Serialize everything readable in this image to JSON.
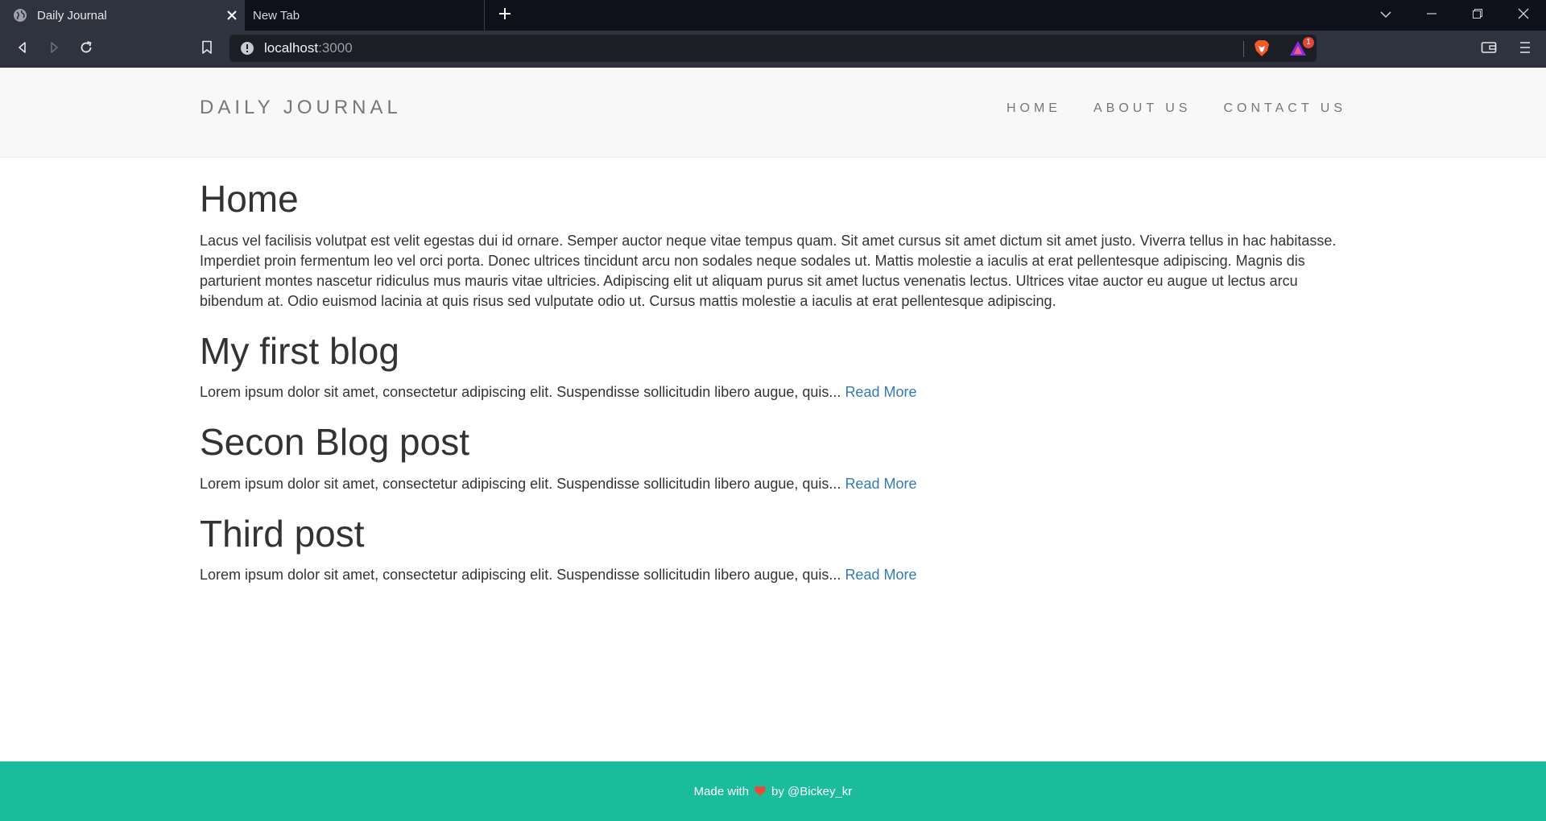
{
  "browser": {
    "tabs": [
      {
        "title": "Daily Journal",
        "active": true
      },
      {
        "title": "New Tab",
        "active": false
      }
    ],
    "url": {
      "host": "localhost",
      "port": ":3000"
    },
    "rewards_badge": "1"
  },
  "site": {
    "brand": "DAILY JOURNAL",
    "nav": [
      {
        "label": "HOME"
      },
      {
        "label": "ABOUT US"
      },
      {
        "label": "CONTACT US"
      }
    ],
    "page_title": "Home",
    "intro": "Lacus vel facilisis volutpat est velit egestas dui id ornare. Semper auctor neque vitae tempus quam. Sit amet cursus sit amet dictum sit amet justo. Viverra tellus in hac habitasse. Imperdiet proin fermentum leo vel orci porta. Donec ultrices tincidunt arcu non sodales neque sodales ut. Mattis molestie a iaculis at erat pellentesque adipiscing. Magnis dis parturient montes nascetur ridiculus mus mauris vitae ultricies. Adipiscing elit ut aliquam purus sit amet luctus venenatis lectus. Ultrices vitae auctor eu augue ut lectus arcu bibendum at. Odio euismod lacinia at quis risus sed vulputate odio ut. Cursus mattis molestie a iaculis at erat pellentesque adipiscing.",
    "posts": [
      {
        "title": "My first blog",
        "excerpt": "Lorem ipsum dolor sit amet, consectetur adipiscing elit. Suspendisse sollicitudin libero augue, quis...",
        "read_more": "Read More"
      },
      {
        "title": "Secon Blog post",
        "excerpt": "Lorem ipsum dolor sit amet, consectetur adipiscing elit. Suspendisse sollicitudin libero augue, quis...",
        "read_more": "Read More"
      },
      {
        "title": "Third post",
        "excerpt": "Lorem ipsum dolor sit amet, consectetur adipiscing elit. Suspendisse sollicitudin libero augue, quis...",
        "read_more": "Read More"
      }
    ],
    "footer": {
      "made_with": "Made with",
      "by": "by @Bickey_kr"
    }
  },
  "colors": {
    "footer_bg": "#1abc9c",
    "link": "#337ab7",
    "heart": "#e74c3c"
  },
  "icons": [
    "globe-icon",
    "close-icon",
    "plus-icon",
    "chevron-down-icon",
    "minimize-icon",
    "restore-icon",
    "back-icon",
    "forward-icon",
    "reload-icon",
    "bookmark-icon",
    "info-icon",
    "brave-shield-icon",
    "brave-rewards-icon",
    "wallet-icon",
    "menu-icon",
    "heart-icon"
  ]
}
